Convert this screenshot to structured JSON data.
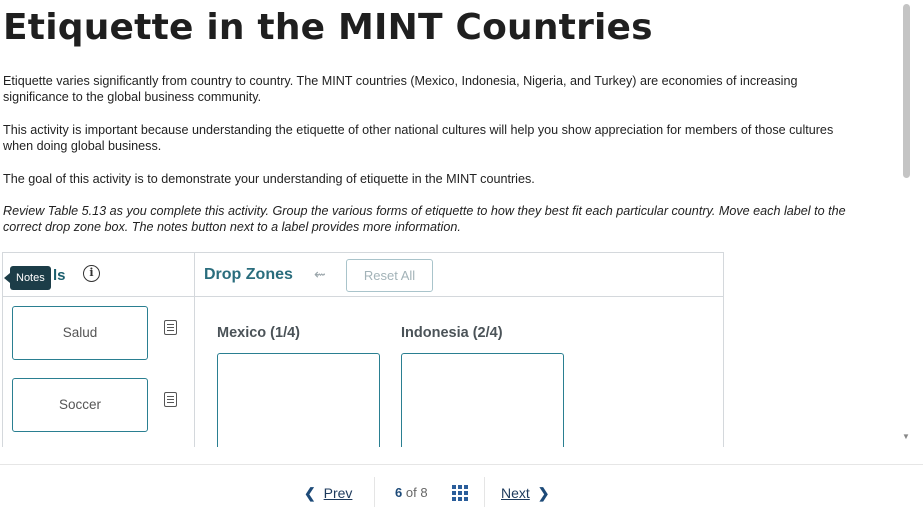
{
  "page": {
    "title": "Etiquette in the MINT Countries",
    "paragraphs": [
      "Etiquette varies significantly from country to country. The MINT countries (Mexico, Indonesia, Nigeria, and Turkey) are economies of increasing significance to the global business community.",
      "This activity is important because understanding the etiquette of other national cultures will help you show appreciation for members of those cultures when doing global business.",
      "The goal of this activity is to demonstrate your understanding of etiquette in the MINT countries.",
      "Review Table 5.13 as you complete this activity. Group the various forms of etiquette to how they best fit each particular country. Move each label to the correct drop zone box. The notes button next to a label provides more information."
    ]
  },
  "activity": {
    "labels_heading": "ls",
    "info_icon": "ⓘ",
    "notes_tooltip": "Notes",
    "drop_zones_heading": "Drop Zones",
    "reset_label": "Reset All",
    "labels": [
      {
        "text": "Salud"
      },
      {
        "text": "Soccer"
      }
    ],
    "zones": [
      {
        "title": "Mexico (1/4)"
      },
      {
        "title": "Indonesia (2/4)"
      }
    ]
  },
  "footer": {
    "prev_label": "Prev",
    "next_label": "Next",
    "current_page": "6",
    "of_label": "of",
    "total_pages": "8"
  },
  "colors": {
    "accent": "#2a7f91",
    "heading_teal": "#2a6d7d",
    "nav_blue": "#1d4a78",
    "tooltip_bg": "#1c3d48"
  },
  "icons": [
    "info-icon",
    "undo-icon",
    "note-icon",
    "grid-icon",
    "chevron-left-icon",
    "chevron-right-icon"
  ]
}
